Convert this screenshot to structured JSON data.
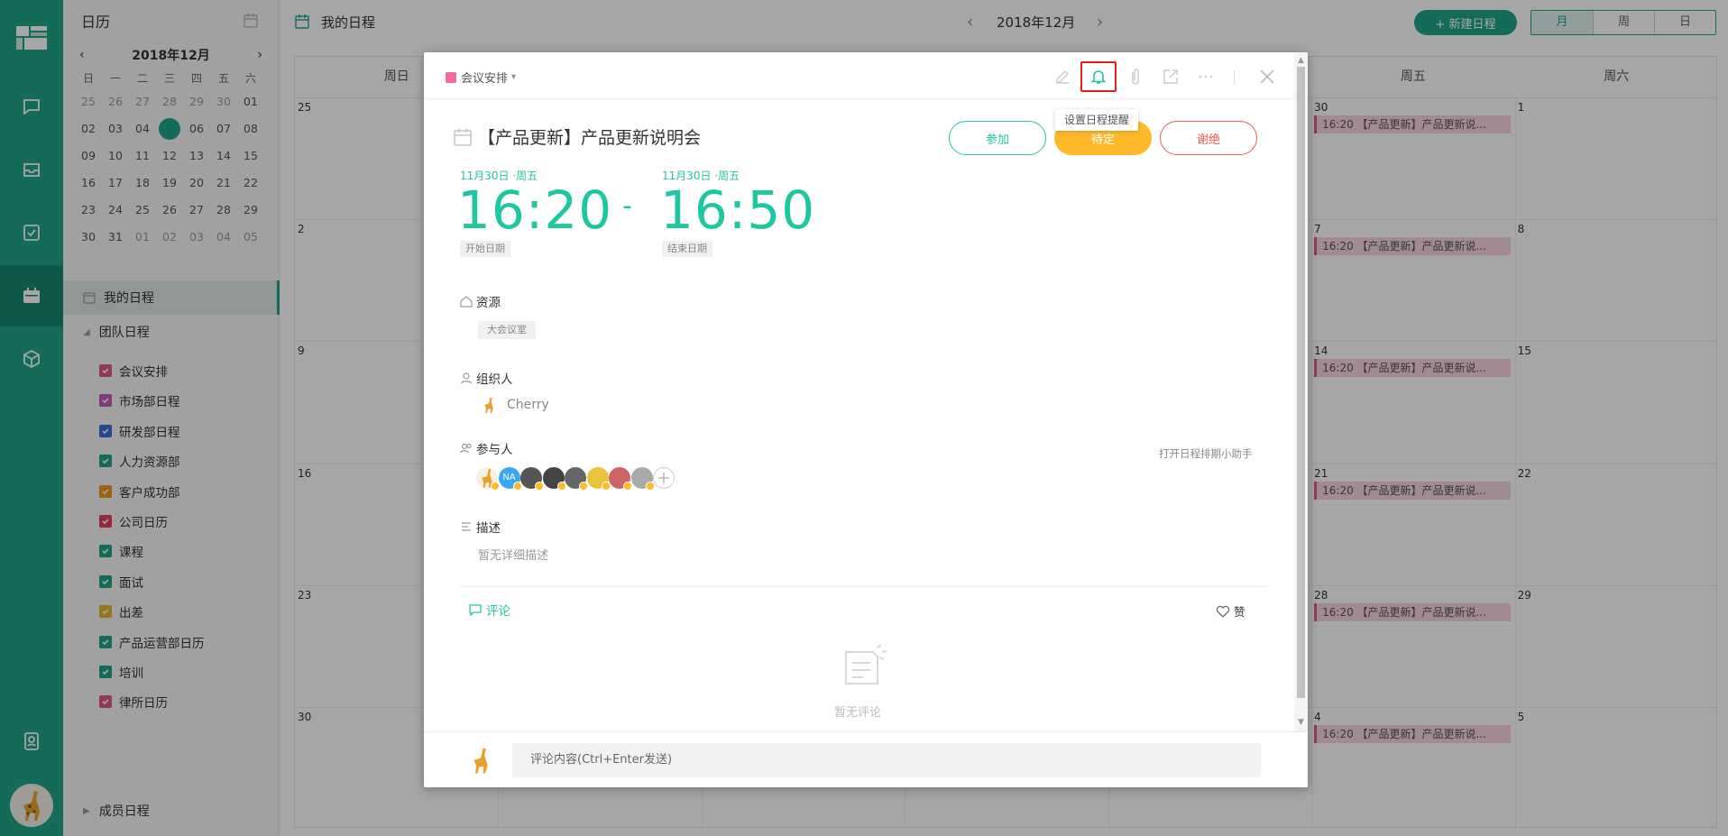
{
  "rail": {
    "items": [
      "logo-icon",
      "chat-icon",
      "inbox-icon",
      "task-icon",
      "calendar-icon",
      "cube-icon",
      "contacts-icon",
      "avatar"
    ]
  },
  "sidebar": {
    "title": "日历",
    "mini_calendar": {
      "month": "2018年12月",
      "weekdays": [
        "日",
        "一",
        "二",
        "三",
        "四",
        "五",
        "六"
      ],
      "weeks": [
        [
          "25",
          "26",
          "27",
          "28",
          "29",
          "30",
          "01"
        ],
        [
          "02",
          "03",
          "04",
          "05",
          "06",
          "07",
          "08"
        ],
        [
          "09",
          "10",
          "11",
          "12",
          "13",
          "14",
          "15"
        ],
        [
          "16",
          "17",
          "18",
          "19",
          "20",
          "21",
          "22"
        ],
        [
          "23",
          "24",
          "25",
          "26",
          "27",
          "28",
          "29"
        ],
        [
          "30",
          "31",
          "01",
          "02",
          "03",
          "04",
          "05"
        ]
      ],
      "today": "05"
    },
    "my_schedule": "我的日程",
    "team_schedule": "团队日程",
    "calendars": [
      {
        "label": "会议安排",
        "color": "#e0588a"
      },
      {
        "label": "市场部日程",
        "color": "#c75bbd"
      },
      {
        "label": "研发部日程",
        "color": "#3b6fd8"
      },
      {
        "label": "人力资源部",
        "color": "#1fa58b"
      },
      {
        "label": "客户成功部",
        "color": "#f09a1a"
      },
      {
        "label": "公司日历",
        "color": "#e0415c"
      },
      {
        "label": "课程",
        "color": "#1fa58b"
      },
      {
        "label": "面试",
        "color": "#1fa58b"
      },
      {
        "label": "出差",
        "color": "#e3b52e"
      },
      {
        "label": "产品运营部日历",
        "color": "#1fa58b"
      },
      {
        "label": "培训",
        "color": "#1fa58b"
      },
      {
        "label": "律所日历",
        "color": "#e0588a"
      }
    ],
    "member_schedule": "成员日程"
  },
  "topbar": {
    "title": "我的日程",
    "month": "2018年12月",
    "new_button": "+ 新建日程",
    "views": [
      "月",
      "周",
      "日"
    ],
    "active_view": "月"
  },
  "month_grid": {
    "headers": [
      "周日",
      "周一",
      "周二",
      "周三",
      "周四",
      "周五",
      "周六"
    ],
    "week_starts": [
      "25",
      "2",
      "9",
      "16",
      "23",
      "30"
    ],
    "fri_nums": [
      "30",
      "7",
      "14",
      "21",
      "28",
      "4"
    ],
    "sat_nums": [
      "1",
      "8",
      "15",
      "22",
      "29",
      "5"
    ],
    "event_label": "16:20 【产品更新】产品更新说..."
  },
  "modal": {
    "calendar_name": "会议安排",
    "calendar_color": "#e0588a",
    "tooltip": "设置日程提醒",
    "title": "【产品更新】产品更新说明会",
    "btn_join": "参加",
    "btn_pending": "待定",
    "btn_decline": "谢绝",
    "start_date": "11月30日 ·周五",
    "end_date": "11月30日 ·周五",
    "start_time": "16:20",
    "end_time": "16:50",
    "dash": "-",
    "start_label": "开始日期",
    "end_label": "结束日期",
    "resource_label": "资源",
    "resource_value": "大会议室",
    "organizer_label": "组织人",
    "organizer_name": "Cherry",
    "participants_label": "参与人",
    "assistant_link": "打开日程排期小助手",
    "participant_initials": "NA",
    "desc_label": "描述",
    "desc_value": "暂无详细描述",
    "comment_tab": "评论",
    "like_label": "赞",
    "no_comment": "暂无评论",
    "comment_placeholder": "评论内容(Ctrl+Enter发送)",
    "accent": "#1fc7a0"
  }
}
